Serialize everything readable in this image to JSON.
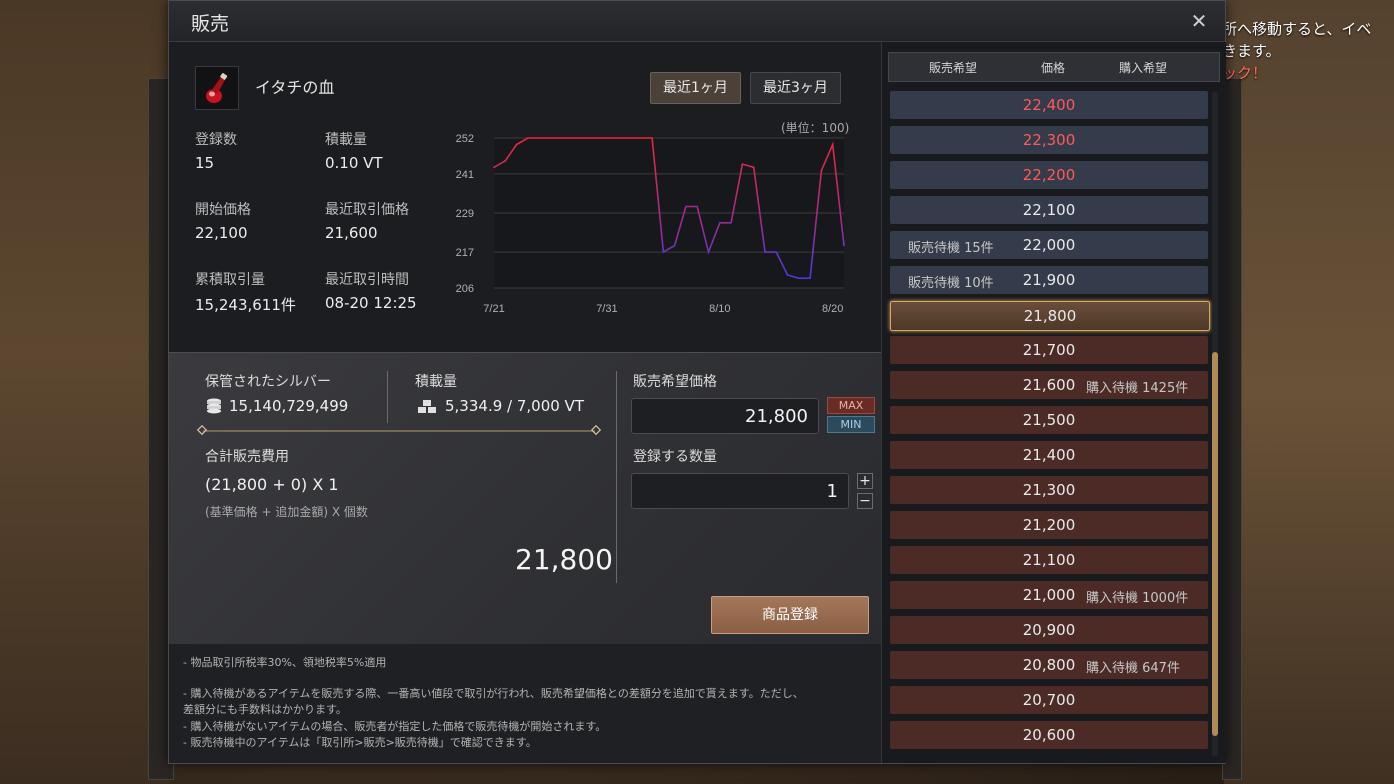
{
  "window": {
    "title": "販売"
  },
  "item": {
    "name": "イタチの血",
    "periods": [
      "最近1ヶ月",
      "最近3ヶ月"
    ]
  },
  "stats": [
    {
      "label": "登録数",
      "value": "15"
    },
    {
      "label": "積載量",
      "value": "0.10 VT"
    },
    {
      "label": "開始価格",
      "value": "22,100"
    },
    {
      "label": "最近取引価格",
      "value": "21,600"
    },
    {
      "label": "累積取引量",
      "value": "15,243,611件"
    },
    {
      "label": "最近取引時間",
      "value": "08-20 12:25"
    }
  ],
  "chart_data": {
    "type": "line",
    "unit_label": "(単位：100)",
    "y_ticks": [
      "252",
      "241",
      "229",
      "217",
      "206"
    ],
    "x_ticks": [
      "7/21",
      "7/31",
      "8/10",
      "8/20"
    ],
    "ylim": [
      206,
      252
    ],
    "x": [
      "7/21",
      "7/22",
      "7/23",
      "7/24",
      "7/25",
      "7/26",
      "7/27",
      "7/28",
      "7/29",
      "7/30",
      "7/31",
      "8/1",
      "8/2",
      "8/3",
      "8/4",
      "8/5",
      "8/6",
      "8/7",
      "8/8",
      "8/9",
      "8/10",
      "8/11",
      "8/12",
      "8/13",
      "8/14",
      "8/15",
      "8/16",
      "8/17",
      "8/18",
      "8/19",
      "8/20",
      "8/21"
    ],
    "series": [
      {
        "values": [
          243,
          245,
          250,
          252,
          252,
          252,
          252,
          252,
          252,
          252,
          252,
          252,
          252,
          252,
          252,
          217,
          219,
          231,
          231,
          217,
          226,
          226,
          244,
          243,
          217,
          217,
          210,
          209,
          209,
          242,
          250,
          219
        ]
      }
    ],
    "color_high": "#e8283c",
    "color_low": "#3a3cf0"
  },
  "sell": {
    "silver_label": "保管されたシルバー",
    "silver_value": "15,140,729,499",
    "weight_label": "積載量",
    "weight_value": "5,334.9 / 7,000 VT",
    "total_label": "合計販売費用",
    "formula": "(21,800 + 0) X 1",
    "formula_note": "(基準価格 + 追加金額) X 個数",
    "total": "21,800",
    "price_label": "販売希望価格",
    "price_value": "21,800",
    "max_label": "MAX",
    "min_label": "MIN",
    "qty_label": "登録する数量",
    "qty_value": "1",
    "plus": "+",
    "minus": "−",
    "register_label": "商品登録"
  },
  "notes": [
    "- 物品取引所税率30%、領地税率5%適用",
    "- 購入待機があるアイテムを販売する際、一番高い値段で取引が行われ、販売希望価格との差額分を追加で貰えます。ただし、",
    "差額分にも手数料はかかります。",
    "- 購入待機がないアイテムの場合、販売者が指定した価格で販売待機が開始されます。",
    "- 販売待機中のアイテムは「取引所>販売>販売待機」で確認できます。"
  ],
  "book": {
    "headers": [
      "販売希望",
      "価格",
      "購入希望"
    ],
    "rows": [
      {
        "price": "22,400",
        "kind": "sell",
        "red": true,
        "left": "",
        "right": ""
      },
      {
        "price": "22,300",
        "kind": "sell",
        "red": true,
        "left": "",
        "right": ""
      },
      {
        "price": "22,200",
        "kind": "sell",
        "red": true,
        "left": "",
        "right": ""
      },
      {
        "price": "22,100",
        "kind": "sell",
        "red": false,
        "left": "",
        "right": ""
      },
      {
        "price": "22,000",
        "kind": "sell",
        "red": false,
        "left": "販売待機 15件",
        "right": ""
      },
      {
        "price": "21,900",
        "kind": "sell",
        "red": false,
        "left": "販売待機 10件",
        "right": ""
      },
      {
        "price": "21,800",
        "kind": "selected",
        "red": false,
        "left": "",
        "right": ""
      },
      {
        "price": "21,700",
        "kind": "buy",
        "red": false,
        "left": "",
        "right": ""
      },
      {
        "price": "21,600",
        "kind": "buy",
        "red": false,
        "left": "",
        "right": "購入待機 1425件"
      },
      {
        "price": "21,500",
        "kind": "buy",
        "red": false,
        "left": "",
        "right": ""
      },
      {
        "price": "21,400",
        "kind": "buy",
        "red": false,
        "left": "",
        "right": ""
      },
      {
        "price": "21,300",
        "kind": "buy",
        "red": false,
        "left": "",
        "right": ""
      },
      {
        "price": "21,200",
        "kind": "buy",
        "red": false,
        "left": "",
        "right": ""
      },
      {
        "price": "21,100",
        "kind": "buy",
        "red": false,
        "left": "",
        "right": ""
      },
      {
        "price": "21,000",
        "kind": "buy",
        "red": false,
        "left": "",
        "right": "購入待機 1000件"
      },
      {
        "price": "20,900",
        "kind": "buy",
        "red": false,
        "left": "",
        "right": ""
      },
      {
        "price": "20,800",
        "kind": "buy",
        "red": false,
        "left": "",
        "right": "購入待機 647件"
      },
      {
        "price": "20,700",
        "kind": "buy",
        "red": false,
        "left": "",
        "right": ""
      },
      {
        "price": "20,600",
        "kind": "buy",
        "red": false,
        "left": "",
        "right": ""
      }
    ]
  },
  "background": {
    "lines": [
      "所へ移動すると、イベ",
      "きます。",
      "ック！"
    ]
  }
}
